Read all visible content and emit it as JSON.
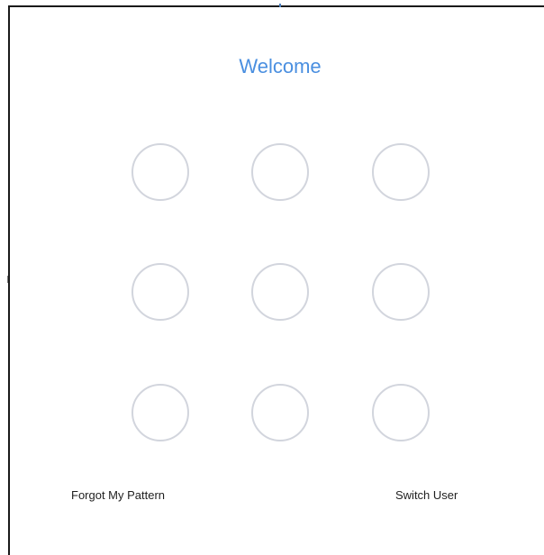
{
  "screen": {
    "title": "Welcome",
    "title_color": "#4a8fe0"
  },
  "pattern_grid": {
    "rows": 3,
    "cols": 3,
    "dot_border_color": "#d2d5dd"
  },
  "actions": {
    "forgot_label": "Forgot My Pattern",
    "switch_label": "Switch User"
  }
}
